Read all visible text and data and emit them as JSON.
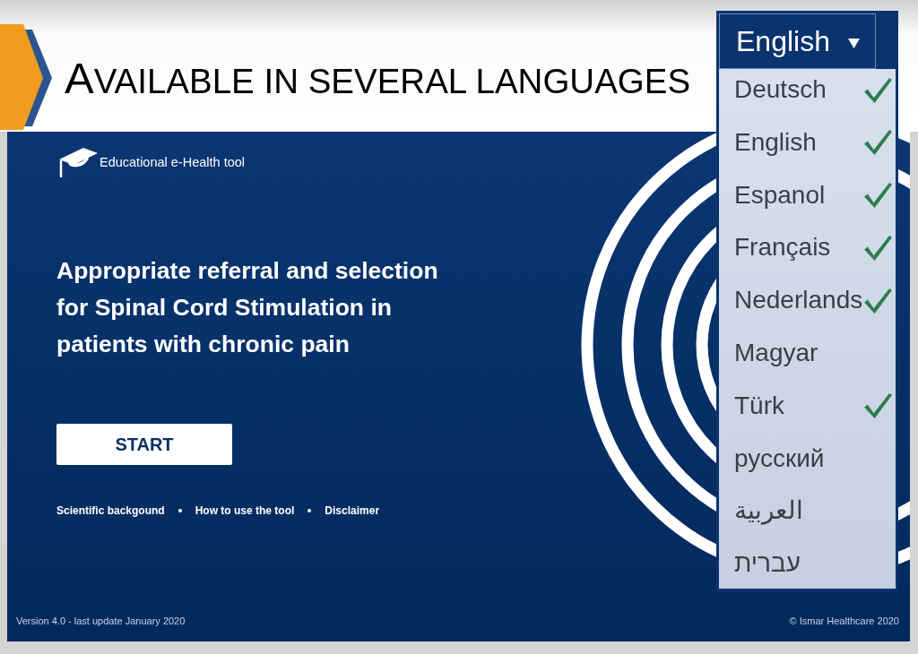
{
  "slide": {
    "title": "AVAILABLE IN SEVERAL LANGUAGES"
  },
  "app": {
    "tagline": "Educational e-Health tool",
    "heading": "Appropriate referral and selection for Spinal Cord Stimulation in patients with chronic pain",
    "start_button": "START",
    "links": [
      "Scientific backgound",
      "How to use the tool",
      "Disclaimer"
    ],
    "version": "Version 4.0 - last update January 2020",
    "copyright": "© Ismar Healthcare 2020"
  },
  "language_menu": {
    "current": "English",
    "options": [
      {
        "label": "Deutsch",
        "checked": true
      },
      {
        "label": "English",
        "checked": true
      },
      {
        "label": "Espanol",
        "checked": true
      },
      {
        "label": "Français",
        "checked": true
      },
      {
        "label": "Nederlands",
        "checked": true
      },
      {
        "label": "Magyar",
        "checked": false
      },
      {
        "label": "Türk",
        "checked": true
      },
      {
        "label": "русский",
        "checked": false
      },
      {
        "label": "العربية",
        "checked": false
      },
      {
        "label": "עברית",
        "checked": false
      }
    ]
  }
}
